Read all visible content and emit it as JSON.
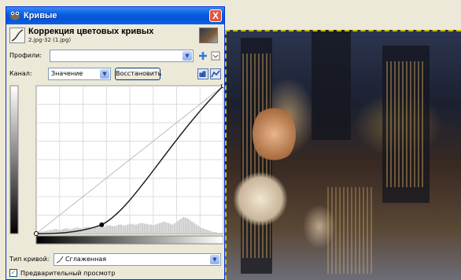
{
  "window": {
    "title": "Кривые",
    "close_glyph": "X"
  },
  "header": {
    "title": "Коррекция цветовых кривых",
    "subtitle": "2.jpg-32 (1.jpg)"
  },
  "profiles": {
    "label": "Профили:",
    "value": ""
  },
  "channel": {
    "label": "Канал:",
    "value": "Значение",
    "reset_label": "Восстановить"
  },
  "curve": {
    "points": [
      [
        0,
        0
      ],
      [
        0.35,
        0.06
      ],
      [
        1,
        1
      ]
    ],
    "histogram": [
      0,
      2,
      3,
      3,
      4,
      4,
      5,
      5,
      6,
      6,
      5,
      5,
      6,
      7,
      7,
      6,
      6,
      7,
      8,
      8,
      7,
      7,
      8,
      9,
      9,
      8,
      8,
      9,
      10,
      10,
      9,
      9,
      10,
      11,
      11,
      10,
      10,
      11,
      12,
      12,
      11,
      11,
      12,
      13,
      13,
      12,
      12,
      13,
      14,
      14,
      13,
      13,
      12,
      12,
      11,
      12,
      13,
      14,
      15,
      16,
      15,
      14,
      13,
      12,
      14,
      16,
      18,
      20,
      22,
      21,
      20,
      18,
      16,
      14,
      12,
      10,
      8,
      7,
      6,
      5,
      4,
      3,
      2,
      2,
      1,
      1,
      0
    ]
  },
  "curve_type": {
    "label": "Тип кривой:",
    "value": "Сглаженная"
  },
  "preview": {
    "label": "Предварительный просмотр",
    "checked": true
  },
  "colors": {
    "accent": "#0a5ee0",
    "dialog_bg": "#ece9d8"
  }
}
